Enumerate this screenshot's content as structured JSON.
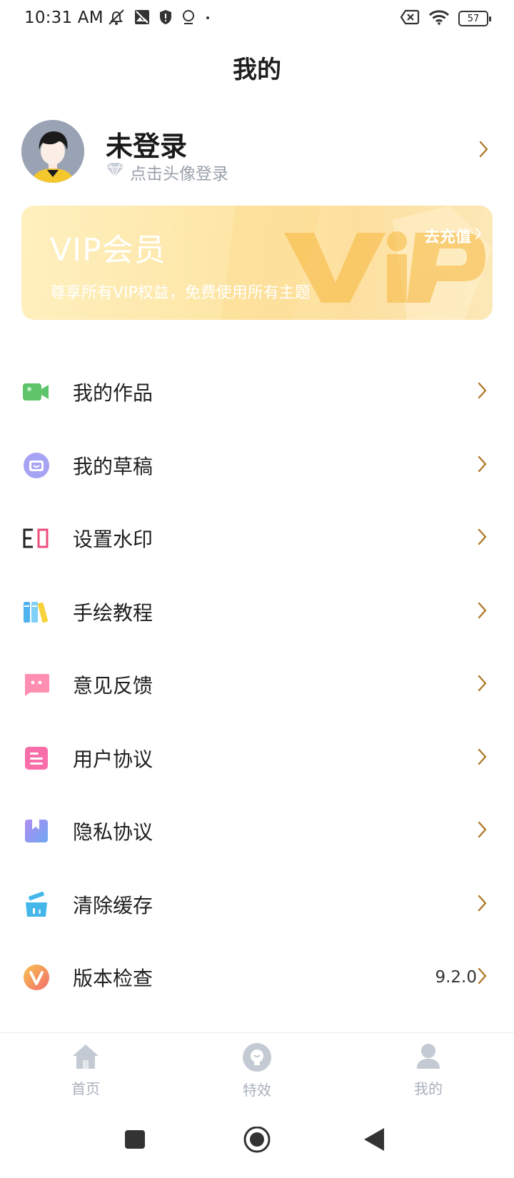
{
  "status_bar": {
    "time": "10:31 AM",
    "battery": "57",
    "icons_left": [
      "muted-bell-icon",
      "gallery-icon",
      "shield-icon",
      "location-pin-icon",
      "dot-icon"
    ],
    "icons_right": [
      "sim-off-icon",
      "wifi-icon",
      "battery-icon"
    ]
  },
  "header": {
    "title": "我的"
  },
  "profile": {
    "name": "未登录",
    "hint": "点击头像登录",
    "badge_icon": "diamond-icon"
  },
  "vip": {
    "title": "VIP会员",
    "subtitle": "尊享所有VIP权益，免费使用所有主题",
    "button": "去充值",
    "watermark": "ViP"
  },
  "menu": {
    "items": [
      {
        "label": "我的作品",
        "icon": "video-camera-icon",
        "color": "#5ec46a"
      },
      {
        "label": "我的草稿",
        "icon": "draft-box-icon",
        "color": "#8f8cf0"
      },
      {
        "label": "设置水印",
        "icon": "watermark-icon",
        "color": "#ee4d7c"
      },
      {
        "label": "手绘教程",
        "icon": "books-icon",
        "color": "#4fb3f0"
      },
      {
        "label": "意见反馈",
        "icon": "feedback-chat-icon",
        "color": "#ff8fb0"
      },
      {
        "label": "用户协议",
        "icon": "document-icon",
        "color": "#f76ea8"
      },
      {
        "label": "隐私协议",
        "icon": "bookmark-book-icon",
        "color": "#8f8cf0"
      },
      {
        "label": "清除缓存",
        "icon": "broom-icon",
        "color": "#44b7ea"
      },
      {
        "label": "版本检查",
        "icon": "version-v-icon",
        "color": "#f7824f",
        "value": "9.2.0"
      }
    ]
  },
  "tabs": [
    {
      "label": "首页",
      "icon": "home-icon"
    },
    {
      "label": "特效",
      "icon": "effects-bulb-icon"
    },
    {
      "label": "我的",
      "icon": "person-icon",
      "active": true
    }
  ],
  "colors": {
    "chevron": "#b07a2a",
    "tab_inactive": "#a9b0bb",
    "vip_bg": "#fde6a6"
  }
}
